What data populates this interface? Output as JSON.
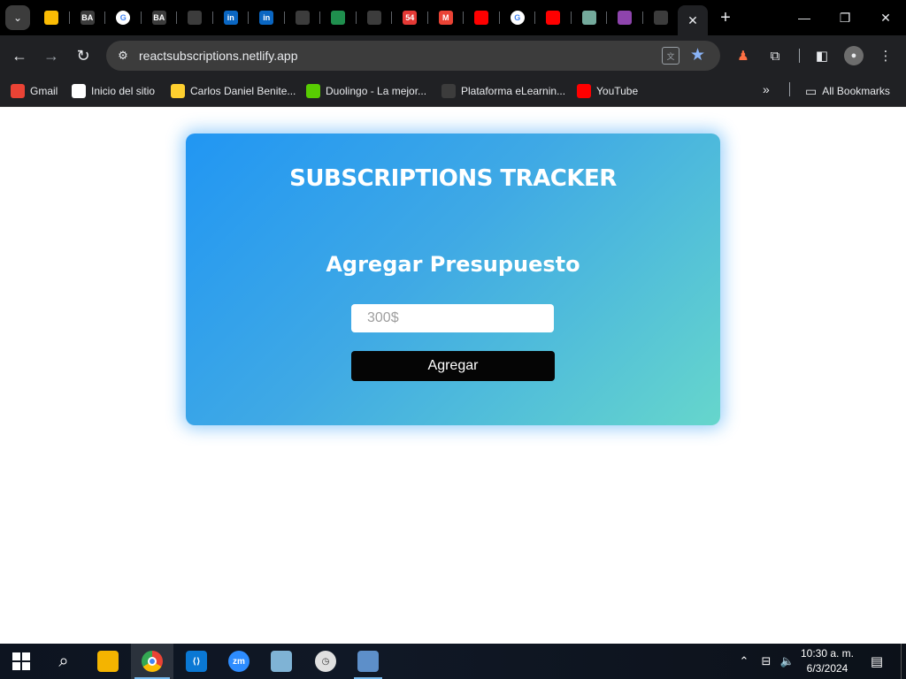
{
  "browser": {
    "pinned_tabs": [
      {
        "icon": "google-drive-icon",
        "label": "",
        "color": "#fbbc04"
      },
      {
        "icon": "ba-icon",
        "label": "BA",
        "color": "#3c3c3c"
      },
      {
        "icon": "google-icon",
        "label": "G",
        "color": "#ffffff"
      },
      {
        "icon": "ba-icon",
        "label": "BA",
        "color": "#3c3c3c"
      },
      {
        "icon": "github-icon",
        "label": "",
        "color": "#3c3c3c"
      },
      {
        "icon": "linkedin-icon",
        "label": "in",
        "color": "#0a66c2"
      },
      {
        "icon": "linkedin-icon",
        "label": "in",
        "color": "#0a66c2"
      },
      {
        "icon": "github-icon",
        "label": "",
        "color": "#3c3c3c"
      },
      {
        "icon": "bolt-icon",
        "label": "",
        "color": "#1f8f4e"
      },
      {
        "icon": "bolt-icon",
        "label": "",
        "color": "#3c3c3c"
      },
      {
        "icon": "notification-icon",
        "label": "54",
        "color": "#e53935"
      },
      {
        "icon": "gmail-icon",
        "label": "M",
        "color": "#ea4335"
      },
      {
        "icon": "youtube-icon",
        "label": "",
        "color": "#ff0000"
      },
      {
        "icon": "google-icon",
        "label": "G",
        "color": "#ffffff"
      },
      {
        "icon": "youtube-icon",
        "label": "",
        "color": "#ff0000"
      },
      {
        "icon": "chatgpt-icon",
        "label": "",
        "color": "#74aa9c"
      },
      {
        "icon": "music-icon",
        "label": "",
        "color": "#8e44ad"
      },
      {
        "icon": "github-icon",
        "label": "",
        "color": "#3c3c3c"
      }
    ],
    "url": "reactsubscriptions.netlify.app",
    "bookmarks": [
      {
        "icon": "gmail-icon",
        "label": "Gmail",
        "color": "#ea4335"
      },
      {
        "icon": "terminal-icon",
        "label": "Inicio del sitio",
        "color": "#ffffff"
      },
      {
        "icon": "miro-icon",
        "label": "Carlos Daniel Benite...",
        "color": "#ffd02f"
      },
      {
        "icon": "duolingo-icon",
        "label": "Duolingo - La mejor...",
        "color": "#58cc02"
      },
      {
        "icon": "coder-icon",
        "label": "Plataforma eLearnin...",
        "color": "#3c3c3c"
      },
      {
        "icon": "youtube-icon",
        "label": "YouTube",
        "color": "#ff0000"
      }
    ],
    "all_bookmarks": "All Bookmarks"
  },
  "app": {
    "title": "SUBSCRIPTIONS TRACKER",
    "subtitle": "Agregar Presupuesto",
    "budget_placeholder": "300$",
    "add_label": "Agregar",
    "accent_start": "#2196f3",
    "accent_end": "#66d6cc"
  },
  "taskbar": {
    "time": "10:30 a. m.",
    "date": "6/3/2024",
    "apps": [
      "search-icon",
      "file-explorer-icon",
      "chrome-icon",
      "vscode-icon",
      "zoom-icon",
      "notes-icon",
      "clock-app-icon",
      "remote-desktop-icon"
    ]
  }
}
